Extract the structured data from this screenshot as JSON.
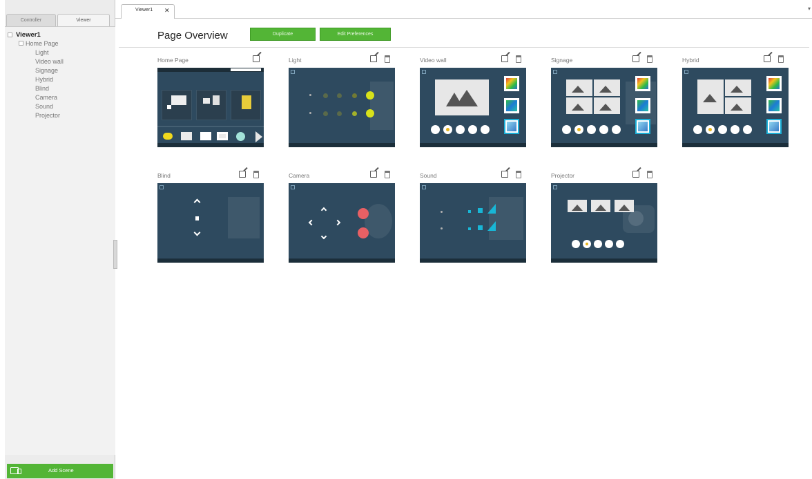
{
  "sidebar": {
    "tabs": [
      "Controller",
      "Viewer"
    ],
    "active_tab": "Viewer",
    "tree": {
      "root": "Viewer1",
      "home": "Home Page",
      "children": [
        "Light",
        "Video wall",
        "Signage",
        "Hybrid",
        "Blind",
        "Camera",
        "Sound",
        "Projector"
      ]
    },
    "add_button": "Add Scene"
  },
  "tabstrip": {
    "tab_label": "Viewer1",
    "close_symbol": "✕",
    "dropdown_symbol": "▾"
  },
  "main": {
    "title": "Page Overview",
    "buttons": [
      "Duplicate",
      "Edit Preferences"
    ]
  },
  "cards": [
    {
      "label": "Home Page",
      "editable": true,
      "deletable": false
    },
    {
      "label": "Light",
      "editable": true,
      "deletable": true
    },
    {
      "label": "Video wall",
      "editable": true,
      "deletable": true
    },
    {
      "label": "Signage",
      "editable": true,
      "deletable": true
    },
    {
      "label": "Hybrid",
      "editable": true,
      "deletable": true
    },
    {
      "label": "Blind",
      "editable": true,
      "deletable": true
    },
    {
      "label": "Camera",
      "editable": true,
      "deletable": true
    },
    {
      "label": "Sound",
      "editable": true,
      "deletable": true
    },
    {
      "label": "Projector",
      "editable": true,
      "deletable": true
    }
  ],
  "colors": {
    "accent_green": "#53b536",
    "thumb_background": "#2e4a5f",
    "light_on": "#d8e21a",
    "camera_red": "#e86064",
    "sound_cyan": "#18b6d6"
  }
}
